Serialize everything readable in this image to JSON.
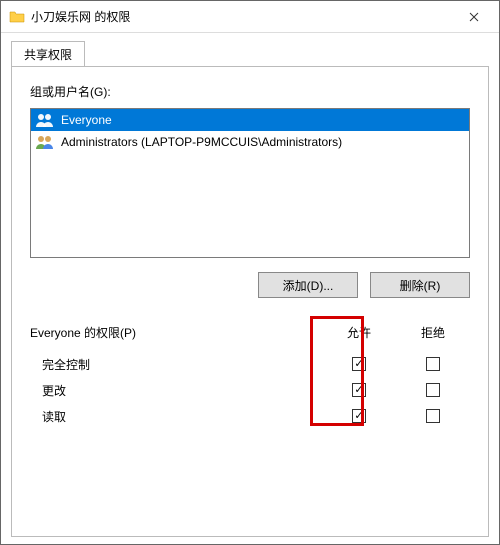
{
  "window": {
    "title": "小刀娱乐网 的权限"
  },
  "tab": {
    "label": "共享权限"
  },
  "groups_label": "组或用户名(G):",
  "list": {
    "items": [
      {
        "name": "Everyone",
        "selected": true
      },
      {
        "name": "Administrators (LAPTOP-P9MCCUIS\\Administrators)",
        "selected": false
      }
    ]
  },
  "buttons": {
    "add": "添加(D)...",
    "remove": "删除(R)"
  },
  "perm": {
    "label": "Everyone 的权限(P)",
    "col_allow": "允许",
    "col_deny": "拒绝",
    "rows": [
      {
        "name": "完全控制",
        "allow": true,
        "deny": false
      },
      {
        "name": "更改",
        "allow": true,
        "deny": false
      },
      {
        "name": "读取",
        "allow": true,
        "deny": false
      }
    ]
  }
}
